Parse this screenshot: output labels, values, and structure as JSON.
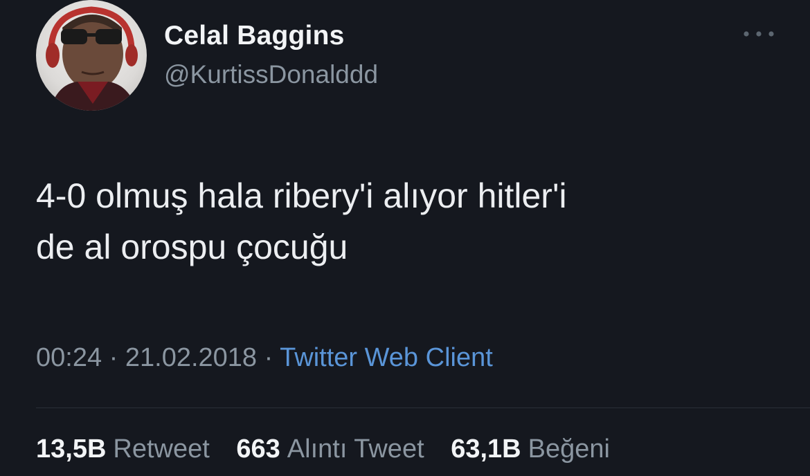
{
  "author": {
    "display_name": "Celal Baggins",
    "handle": "@KurtissDonalddd"
  },
  "more_icon": "more-horizontal-icon",
  "tweet": {
    "text_line_1": "4-0 olmuş hala ribery'i alıyor hitler'i",
    "text_line_2": "de al orospu çocuğu"
  },
  "meta": {
    "time": "00:24",
    "separator": "·",
    "date": "21.02.2018",
    "source": "Twitter Web Client"
  },
  "stats": {
    "retweets_count": "13,5B",
    "retweets_label": "Retweet",
    "quotes_count": "663",
    "quotes_label": "Alıntı Tweet",
    "likes_count": "63,1B",
    "likes_label": "Beğeni"
  },
  "colors": {
    "background": "#15181f",
    "primary_text": "#f2f4f6",
    "secondary_text": "#8b96a1",
    "link": "#5a95d8",
    "divider": "#2a2f37"
  }
}
